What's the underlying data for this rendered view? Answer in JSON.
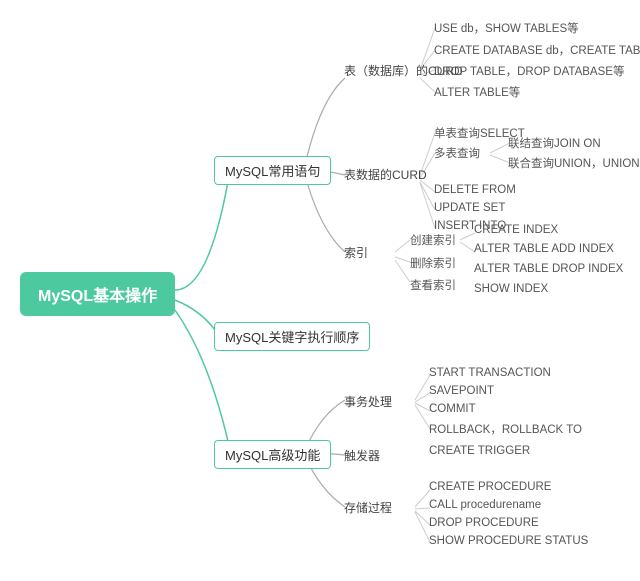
{
  "root": "MySQL基本操作",
  "branches": [
    {
      "id": "b1",
      "label": "MySQL常用语句",
      "sub": [
        {
          "id": "b1s1",
          "label": "表（数据库）的CURD",
          "leaves": [
            "USE db，SHOW TABLES等",
            "CREATE DATABASE db，CREATE TABLE等",
            "DROP TABLE，DROP DATABASE等",
            "ALTER TABLE等"
          ]
        },
        {
          "id": "b1s2",
          "label": "表数据的CURD",
          "sub": [
            {
              "id": "b1s2a",
              "label": "单表查询SELECT"
            },
            {
              "id": "b1s2b",
              "label": "多表查询",
              "leaves": [
                "联结查询JOIN ON",
                "联合查询UNION，UNION ALL"
              ]
            },
            {
              "id": "b1s2c",
              "label": "DELETE FROM"
            },
            {
              "id": "b1s2d",
              "label": "UPDATE SET"
            },
            {
              "id": "b1s2e",
              "label": "INSERT INTO"
            }
          ]
        },
        {
          "id": "b1s3",
          "label": "索引",
          "sub": [
            {
              "id": "b1s3a",
              "label": "创建索引",
              "leaves": [
                "CREATE INDEX",
                "ALTER TABLE ADD INDEX"
              ]
            },
            {
              "id": "b1s3b",
              "label": "删除索引",
              "leaves": [
                "ALTER TABLE DROP INDEX"
              ]
            },
            {
              "id": "b1s3c",
              "label": "查看索引",
              "leaves": [
                "SHOW INDEX"
              ]
            }
          ]
        }
      ]
    },
    {
      "id": "b2",
      "label": "MySQL关键字执行顺序"
    },
    {
      "id": "b3",
      "label": "MySQL高级功能",
      "sub": [
        {
          "id": "b3s1",
          "label": "事务处理",
          "leaves": [
            "START TRANSACTION",
            "SAVEPOINT",
            "COMMIT",
            "ROLLBACK，ROLLBACK TO"
          ]
        },
        {
          "id": "b3s2",
          "label": "触发器",
          "leaves": [
            "CREATE TRIGGER"
          ]
        },
        {
          "id": "b3s3",
          "label": "存储过程",
          "leaves": [
            "CREATE PROCEDURE",
            "CALL procedurename",
            "DROP PROCEDURE",
            "SHOW PROCEDURE STATUS"
          ]
        }
      ]
    }
  ]
}
